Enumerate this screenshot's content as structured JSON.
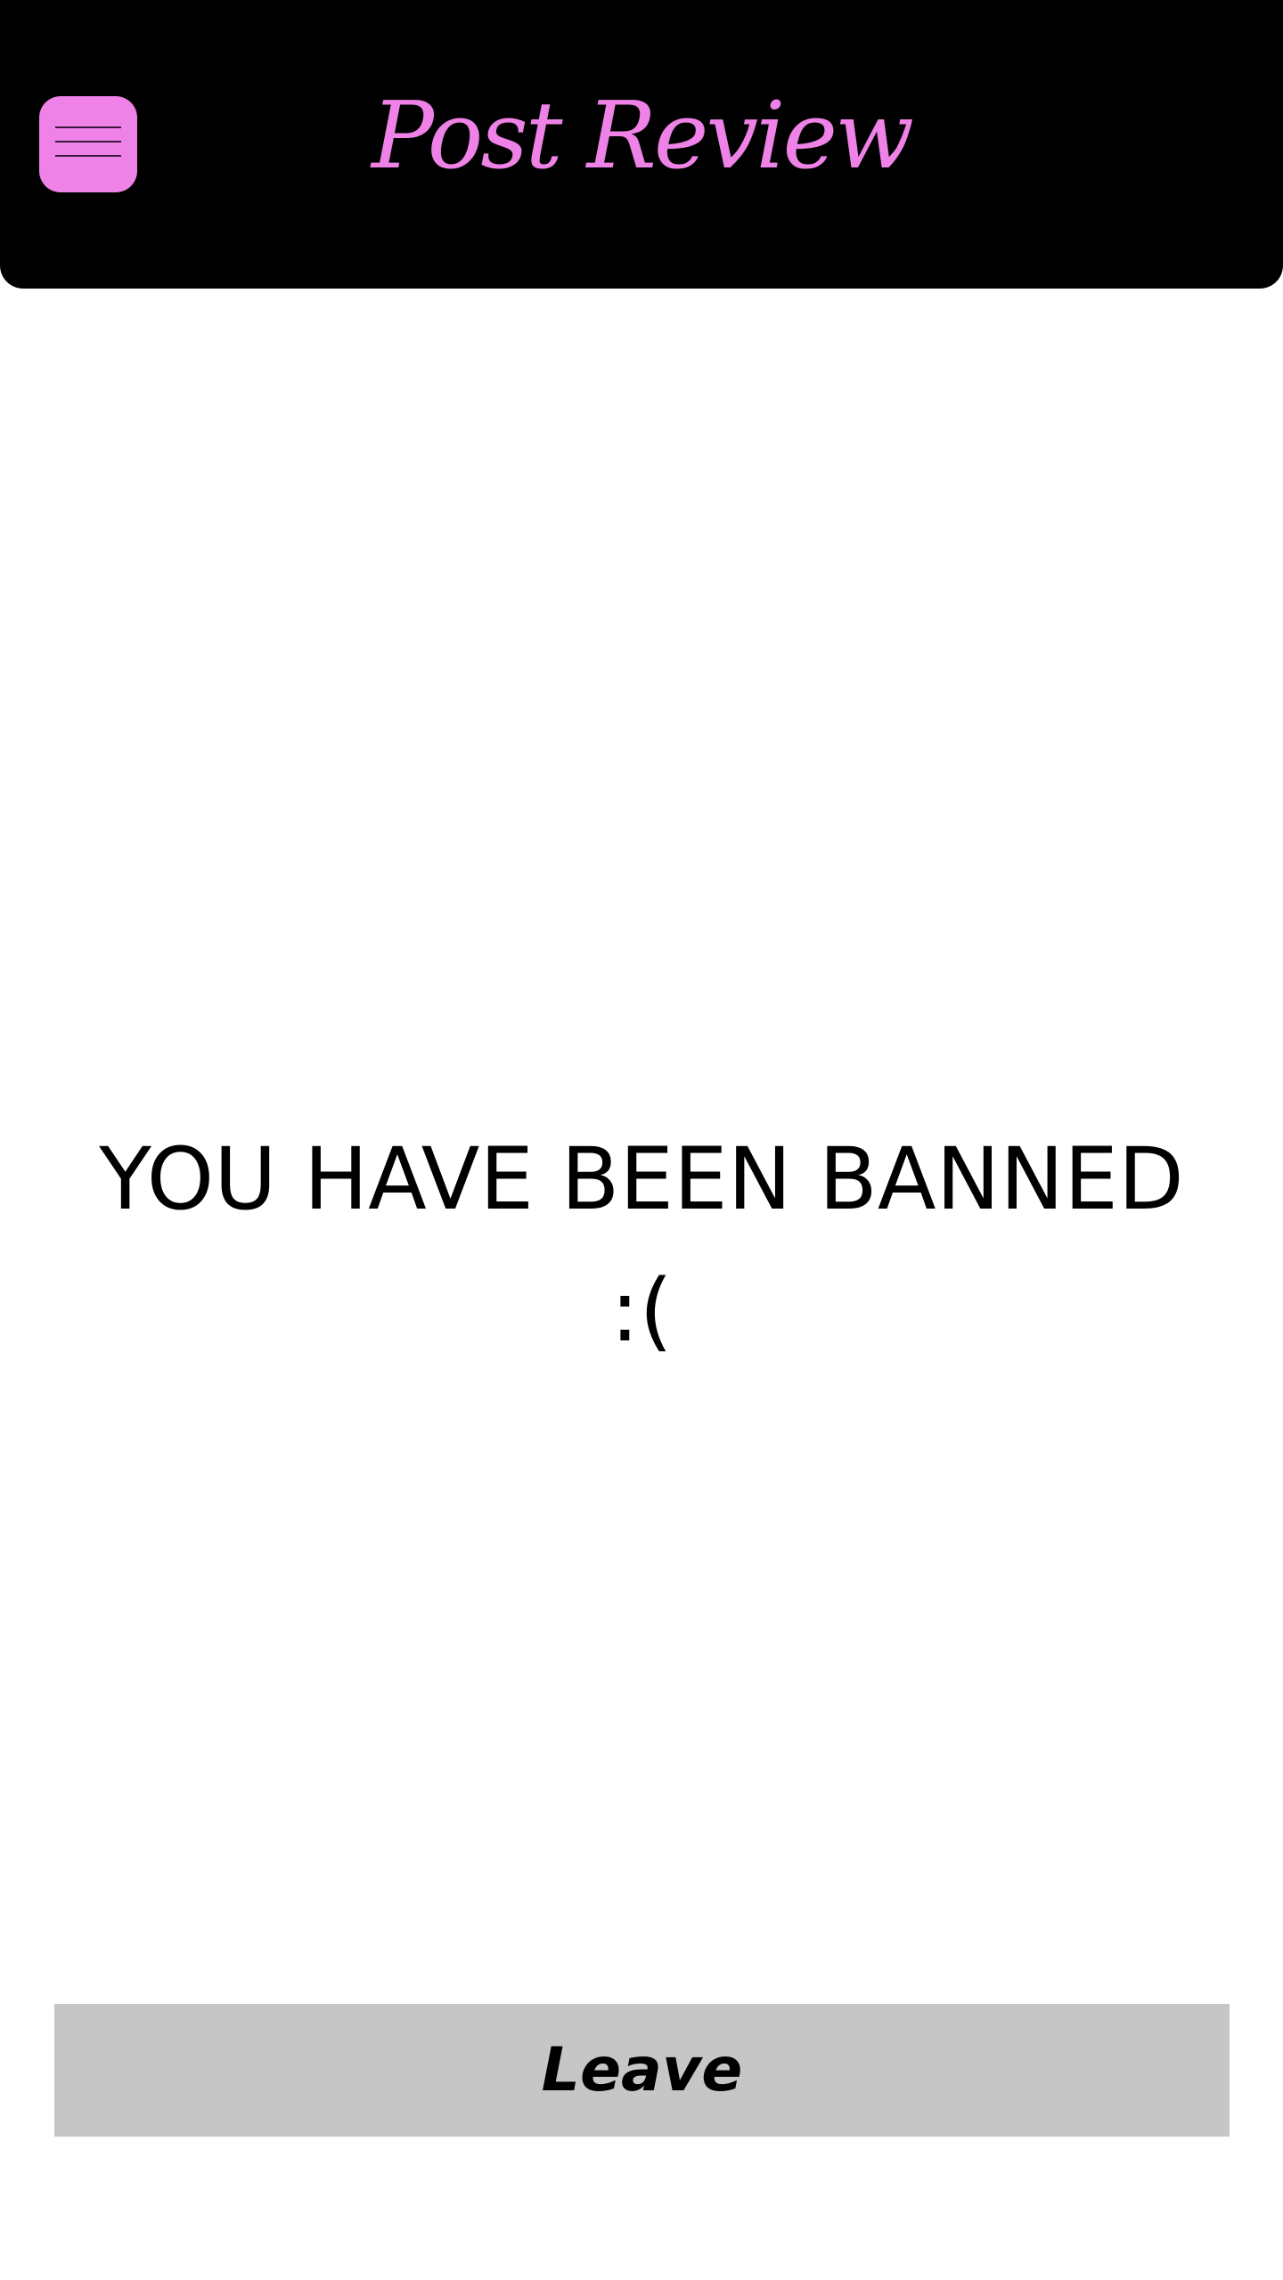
{
  "header": {
    "title": "Post Review",
    "menu_icon": "hamburger-menu-icon",
    "background_color": "#000000",
    "accent_color": "#ee82e6"
  },
  "main": {
    "message_line1": "YOU HAVE BEEN BANNED",
    "message_line2": ":("
  },
  "footer": {
    "leave_label": "Leave",
    "button_color": "#c6c6c6"
  }
}
